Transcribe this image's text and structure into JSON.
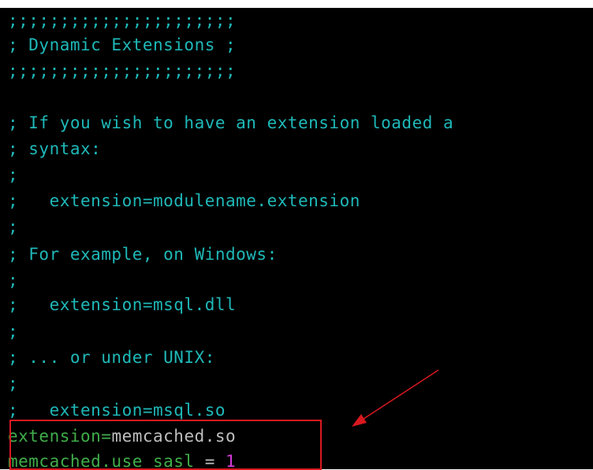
{
  "terminal": {
    "lines": [
      ";;;;;;;;;;;;;;;;;;;;;;",
      "; Dynamic Extensions ;",
      ";;;;;;;;;;;;;;;;;;;;;;",
      "",
      "; If you wish to have an extension loaded a",
      "; syntax:",
      ";",
      ";   extension=modulename.extension",
      ";",
      "; For example, on Windows:",
      ";",
      ";   extension=msql.dll",
      ";",
      "; ... or under UNIX:",
      ";",
      ";   extension=msql.so"
    ],
    "config_lines": [
      {
        "key": "extension",
        "op": "=",
        "value": "memcached.so"
      },
      {
        "key": "memcached.use_sasl",
        "op": " = ",
        "value": "1"
      }
    ]
  },
  "colors": {
    "background": "#000000",
    "comment": "#1fb8b8",
    "key": "#3fae49",
    "value": "#bfbfbf",
    "number": "#d23bd6",
    "annotation": "#d8191f"
  }
}
